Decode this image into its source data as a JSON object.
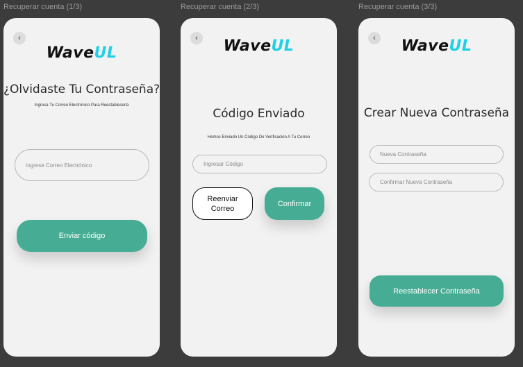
{
  "screens": [
    {
      "frame_label": "Recuperar cuenta (1/3)",
      "logo": {
        "part1": "Wave",
        "part2": "UL"
      },
      "title": "¿Olvidaste Tu Contraseña?",
      "subtitle": "Ingresa Tu Correo Electrónico Para Reestablecerla",
      "email_placeholder": "Ingrese Correo Electrónico",
      "primary_button": "Enviar código"
    },
    {
      "frame_label": "Recuperar cuenta (2/3)",
      "logo": {
        "part1": "Wave",
        "part2": "UL"
      },
      "title": "Código Enviado",
      "subtitle": "Hemos Enviado Un Código De Verificación A Tu Correo",
      "code_placeholder": "Ingresar Código",
      "resend_button_line1": "Reenviar",
      "resend_button_line2": "Correo",
      "confirm_button": "Confirmar"
    },
    {
      "frame_label": "Recuperar cuenta (3/3)",
      "logo": {
        "part1": "Wave",
        "part2": "UL"
      },
      "title": "Crear Nueva Contraseña",
      "new_password_placeholder": "Nueva Contraseña",
      "confirm_password_placeholder": "Confirmar Nueva Contraseña",
      "primary_button": "Reestablecer Contraseña"
    }
  ],
  "icons": {
    "back": "chevron-left-icon"
  },
  "colors": {
    "canvas": "#3c3c3c",
    "phone_bg": "#f2f2f2",
    "accent": "#46ad94",
    "logo_highlight": "#1fd0e8"
  }
}
